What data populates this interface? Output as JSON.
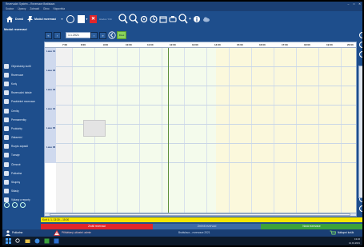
{
  "window": {
    "title": "Rezervační Systém – Rezervace Bratislava",
    "controls": [
      "–",
      "□",
      "✕"
    ]
  },
  "menu": [
    "Soubor",
    "Úpravy",
    "Zobrazit",
    "Okno",
    "Nápověda"
  ],
  "toolbar": {
    "home_label": "Domů",
    "module_label": "Modul rezervací",
    "search_hint": "Hledat / Filtr"
  },
  "sidebar": {
    "title": "Modul rezervací",
    "items": [
      "Objednávky kurtů",
      "Rezervace",
      "Kurty",
      "Rezervační tabule",
      "Pravidelné rezervace",
      "Ceníky",
      "Permanentky",
      "Poukázky",
      "Zákazníci",
      "Rozpis zápasů",
      "Turnaje",
      "Členové",
      "Pokladna",
      "Skupiny",
      "Sklady",
      "Výkazy a reporty",
      "Statistiky",
      "Uživatelé",
      "Nastavení"
    ]
  },
  "nav": {
    "date_value": "1.1.2021",
    "today_label": "Dnes"
  },
  "grid": {
    "times": [
      "7:00",
      "8:00",
      "9:00",
      "10:00",
      "11:00",
      "12:00",
      "13:00",
      "14:00",
      "15:00",
      "16:00",
      "17:00",
      "18:00",
      "19:00",
      "20:00"
    ],
    "lanes": [
      "Lane 01",
      "Lane 02",
      "Lane 03",
      "Lane 04",
      "Lane 05",
      "Lane 06"
    ]
  },
  "status": {
    "message": "Kurt č. 1, 13:30 – 15:00",
    "delete": "Zrušit rezervaci",
    "change": "Změnit rezervaci",
    "create": "Nová rezervace",
    "info_left": "Pokladna",
    "info_user": "Přihlášený uživatel: admin",
    "info_center": "Bratislava – rezervace 2021",
    "cart": "Nákupní košík"
  },
  "clock": {
    "time": "13:22",
    "date": "14.01.2021"
  },
  "colors": {
    "brand": "#1e4e8c",
    "status_yellow": "#f7e600",
    "delete_red": "#e0262b",
    "create_green": "#3ba23c"
  }
}
